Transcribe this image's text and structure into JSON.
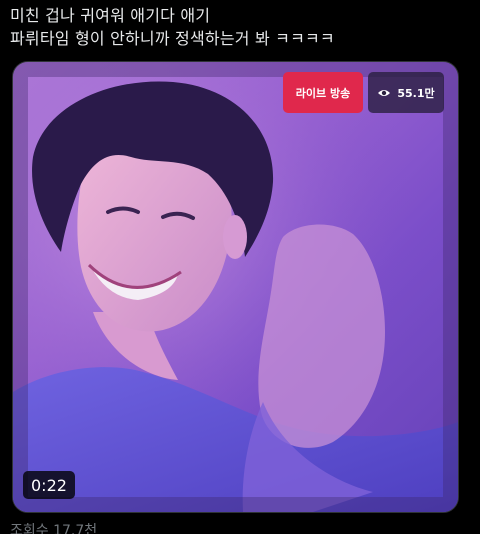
{
  "tweet": {
    "lines": [
      "미친 겁나 귀여워 애기다 애기",
      "파뤼타임 형이 안하니까 정색하는거 봐 ㅋㅋㅋㅋ"
    ]
  },
  "media": {
    "live_badge_label": "라이브 방송",
    "viewer_count": "55.1만",
    "viewer_icon": "eye-icon",
    "duration": "0:22"
  },
  "footer": {
    "views_text": "조회수 17.7천"
  },
  "colors": {
    "background": "#000000",
    "text": "#e7e9ea",
    "muted": "#71767b",
    "live_red": "#e0284c",
    "video_purple": "#9a63d2"
  }
}
